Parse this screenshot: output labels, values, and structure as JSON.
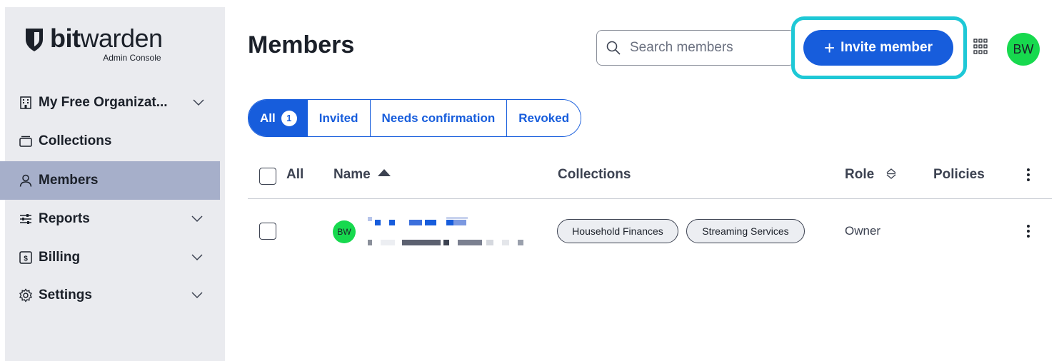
{
  "brand": {
    "name_bold": "bit",
    "name_light": "warden",
    "subtitle": "Admin Console"
  },
  "sidebar": {
    "items": [
      {
        "label": "My Free Organizat...",
        "icon": "building-icon",
        "has_chevron": true
      },
      {
        "label": "Collections",
        "icon": "collection-icon",
        "has_chevron": false
      },
      {
        "label": "Members",
        "icon": "user-icon",
        "has_chevron": false,
        "active": true
      },
      {
        "label": "Reports",
        "icon": "sliders-icon",
        "has_chevron": true
      },
      {
        "label": "Billing",
        "icon": "billing-icon",
        "has_chevron": true
      },
      {
        "label": "Settings",
        "icon": "gear-icon",
        "has_chevron": true
      }
    ]
  },
  "header": {
    "title": "Members",
    "search_placeholder": "Search members",
    "invite_label": "Invite member",
    "avatar_initials": "BW"
  },
  "tabs": [
    {
      "label": "All",
      "count": "1",
      "active": true
    },
    {
      "label": "Invited"
    },
    {
      "label": "Needs confirmation"
    },
    {
      "label": "Revoked"
    }
  ],
  "table": {
    "columns": {
      "all": "All",
      "name": "Name",
      "collections": "Collections",
      "role": "Role",
      "policies": "Policies"
    },
    "rows": [
      {
        "avatar_initials": "BW",
        "collections": [
          "Household Finances",
          "Streaming Services"
        ],
        "role": "Owner"
      }
    ]
  },
  "colors": {
    "primary": "#175ddc",
    "sidebar_bg": "#eaebef",
    "sidebar_active": "#a6afca",
    "avatar": "#17d94e",
    "highlight": "#1ec8d6"
  }
}
